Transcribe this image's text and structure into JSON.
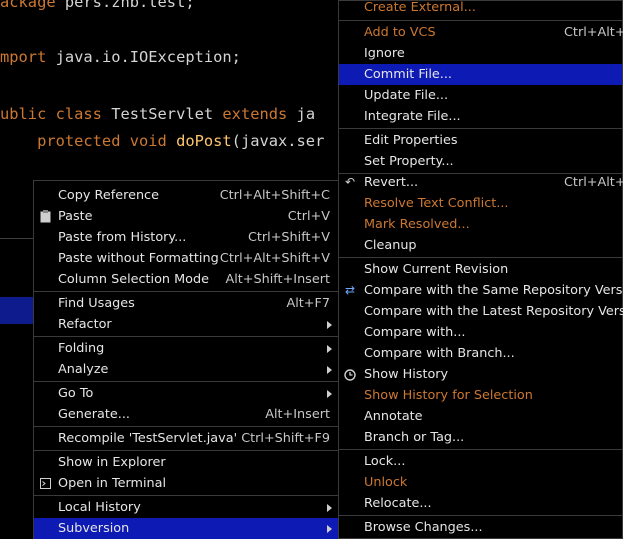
{
  "editor": {
    "lines": [
      [
        "ackage ",
        "pers.zhb.test;"
      ],
      [
        "mport ",
        "java.io.IOException;"
      ],
      [
        "ublic class ",
        "TestServlet ",
        "extends ",
        "ja"
      ],
      [
        "    protected void ",
        "doPost",
        "(javax.ser"
      ]
    ]
  },
  "context_menu": {
    "items": [
      {
        "label": "Copy Reference",
        "shortcut": "Ctrl+Alt+Shift+C"
      },
      {
        "label": "Paste",
        "shortcut": "Ctrl+V",
        "icon": "paste-icon"
      },
      {
        "label": "Paste from History...",
        "shortcut": "Ctrl+Shift+V"
      },
      {
        "label": "Paste without Formatting",
        "shortcut": "Ctrl+Alt+Shift+V"
      },
      {
        "label": "Column Selection Mode",
        "shortcut": "Alt+Shift+Insert"
      },
      {
        "label": "Find Usages",
        "shortcut": "Alt+F7"
      },
      {
        "label": "Refactor",
        "submenu": true
      },
      {
        "label": "Folding",
        "submenu": true
      },
      {
        "label": "Analyze",
        "submenu": true
      },
      {
        "label": "Go To",
        "submenu": true
      },
      {
        "label": "Generate...",
        "shortcut": "Alt+Insert"
      },
      {
        "label": "Recompile 'TestServlet.java'",
        "shortcut": "Ctrl+Shift+F9"
      },
      {
        "label": "Show in Explorer"
      },
      {
        "label": "Open in Terminal",
        "icon": "terminal-icon"
      },
      {
        "label": "Local History",
        "submenu": true
      },
      {
        "label": "Subversion",
        "submenu": true,
        "selected": true
      }
    ]
  },
  "subversion_menu": {
    "items": [
      {
        "label": "Create External...",
        "disabled": true
      },
      {
        "label": "Add to VCS",
        "shortcut": "Ctrl+Alt+A",
        "disabled": true
      },
      {
        "label": "Ignore"
      },
      {
        "label": "Commit File...",
        "selected": true
      },
      {
        "label": "Update File..."
      },
      {
        "label": "Integrate File..."
      },
      {
        "label": "Edit Properties"
      },
      {
        "label": "Set Property..."
      },
      {
        "label": "Revert...",
        "shortcut": "Ctrl+Alt+Z",
        "icon": "revert-icon"
      },
      {
        "label": "Resolve Text Conflict...",
        "disabled": true
      },
      {
        "label": "Mark Resolved...",
        "disabled": true
      },
      {
        "label": "Cleanup"
      },
      {
        "label": "Show Current Revision"
      },
      {
        "label": "Compare with the Same Repository Version",
        "icon": "compare-icon"
      },
      {
        "label": "Compare with the Latest Repository Version"
      },
      {
        "label": "Compare with..."
      },
      {
        "label": "Compare with Branch..."
      },
      {
        "label": "Show History",
        "icon": "clock-icon"
      },
      {
        "label": "Show History for Selection",
        "disabled": true
      },
      {
        "label": "Annotate"
      },
      {
        "label": "Branch or Tag..."
      },
      {
        "label": "Lock..."
      },
      {
        "label": "Unlock",
        "disabled": true
      },
      {
        "label": "Relocate..."
      },
      {
        "label": "Browse Changes..."
      }
    ]
  },
  "colors": {
    "background": "#000000",
    "selection": "#0d1bb4",
    "disabled_text": "#cc7832",
    "keyword": "#cc7832",
    "method": "#ffc66d"
  }
}
